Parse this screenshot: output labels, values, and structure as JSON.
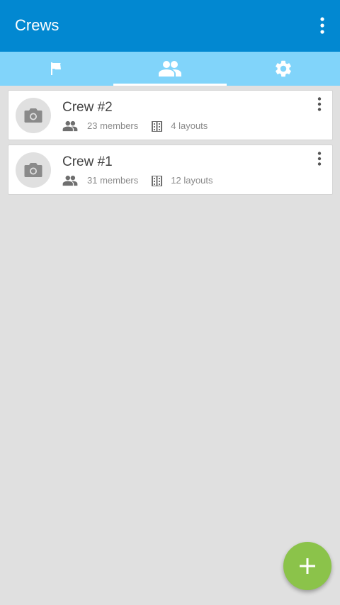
{
  "appbar": {
    "title": "Crews",
    "menu_icon": "more-vert-icon"
  },
  "tabs": [
    {
      "icon": "flag-icon",
      "selected": false
    },
    {
      "icon": "people-icon",
      "selected": true
    },
    {
      "icon": "settings-icon",
      "selected": false
    }
  ],
  "crews": [
    {
      "name": "Crew #2",
      "members": "23 members",
      "layouts": "4 layouts"
    },
    {
      "name": "Crew #1",
      "members": "31 members",
      "layouts": "12 layouts"
    }
  ],
  "fab": {
    "icon": "add-icon"
  },
  "colors": {
    "appbar": "#0288d1",
    "tabbar": "#81d4fa",
    "background": "#e0e0e0",
    "fab": "#8bc34a"
  }
}
